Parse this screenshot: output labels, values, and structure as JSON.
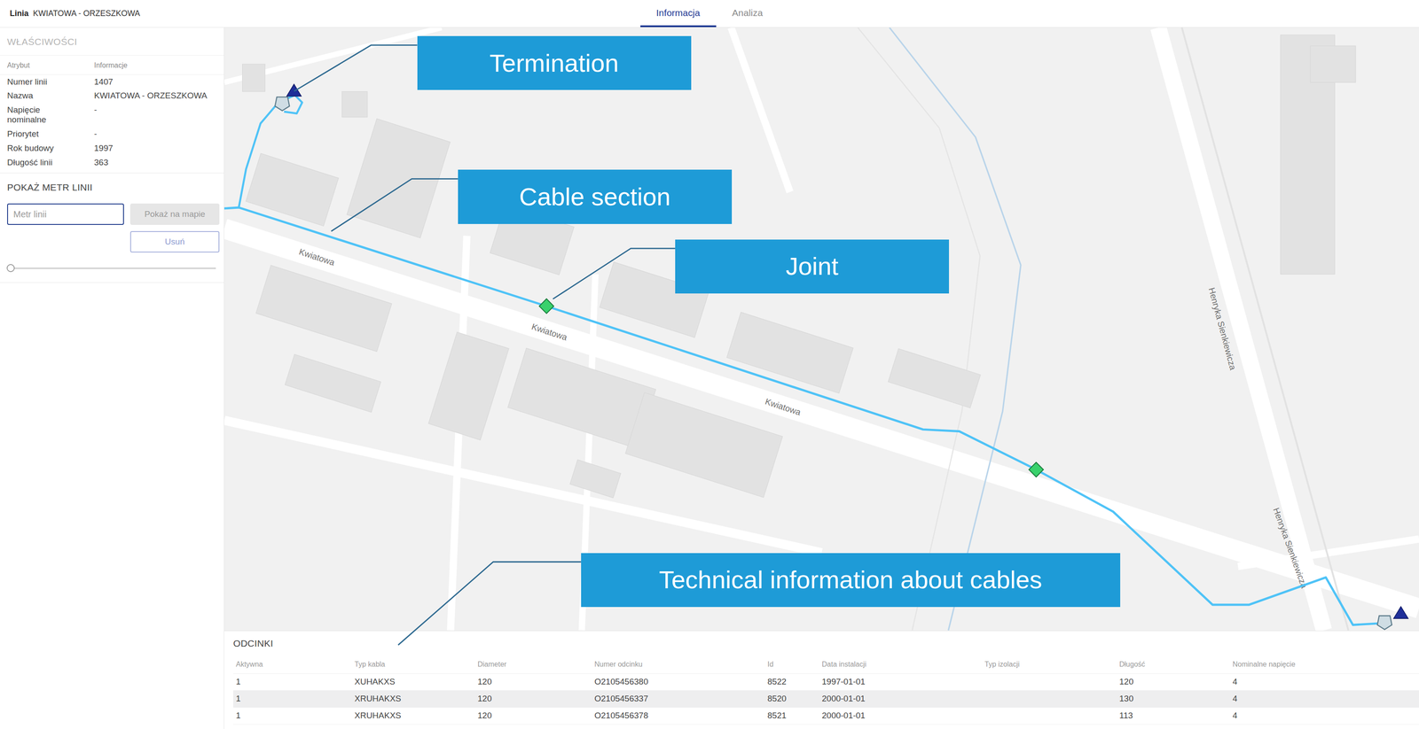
{
  "header": {
    "label": "Linia",
    "line_name": "KWIATOWA - ORZESZKOWA"
  },
  "tabs": [
    {
      "label": "Informacja",
      "selected": true
    },
    {
      "label": "Analiza",
      "selected": false
    }
  ],
  "properties": {
    "title": "WŁAŚCIWOŚCI",
    "columns": [
      "Atrybut",
      "Informacje"
    ],
    "rows": [
      [
        "Numer linii",
        "1407"
      ],
      [
        "Nazwa",
        "KWIATOWA - ORZESZKOWA"
      ],
      [
        "Napięcie nominalne",
        "-"
      ],
      [
        "Priorytet",
        "-"
      ],
      [
        "Rok budowy",
        "1997"
      ],
      [
        "Długość linii",
        "363"
      ]
    ]
  },
  "line_meter": {
    "title": "POKAŻ METR LINII",
    "input": {
      "placeholder": "Metr linii",
      "focused": true
    },
    "buttons": [
      {
        "label": "Pokaż na mapie",
        "disabled": true,
        "kind": "filled"
      },
      {
        "label": "Usuń",
        "disabled": true,
        "kind": "outline"
      }
    ],
    "slider": {
      "level": 0
    }
  },
  "map": {
    "street_labels": [
      "Kwiatowa",
      "Kwiatowa",
      "Kwiatowa",
      "Henryka Sienkiewicza",
      "Henryka Sienkiewicza"
    ]
  },
  "callouts": [
    "Termination",
    "Cable section",
    "Joint",
    "Technical information about cables"
  ],
  "segments": {
    "title": "ODCINKI",
    "columns": [
      "Aktywna",
      "Typ kabla",
      "Diameter",
      "Numer odcinku",
      "Id",
      "Data instalacji",
      "Typ izolacji",
      "Długość",
      "Nominalne napięcie"
    ],
    "rows": [
      [
        "1",
        "XUHAKXS",
        "120",
        "O2105456380",
        "8522",
        "1997-01-01",
        "",
        "120",
        "4"
      ],
      [
        "1",
        "XRUHAKXS",
        "120",
        "O2105456337",
        "8520",
        "2000-01-01",
        "",
        "130",
        "4"
      ],
      [
        "1",
        "XRUHAKXS",
        "120",
        "O2105456378",
        "8521",
        "2000-01-01",
        "",
        "113",
        "4"
      ]
    ]
  }
}
